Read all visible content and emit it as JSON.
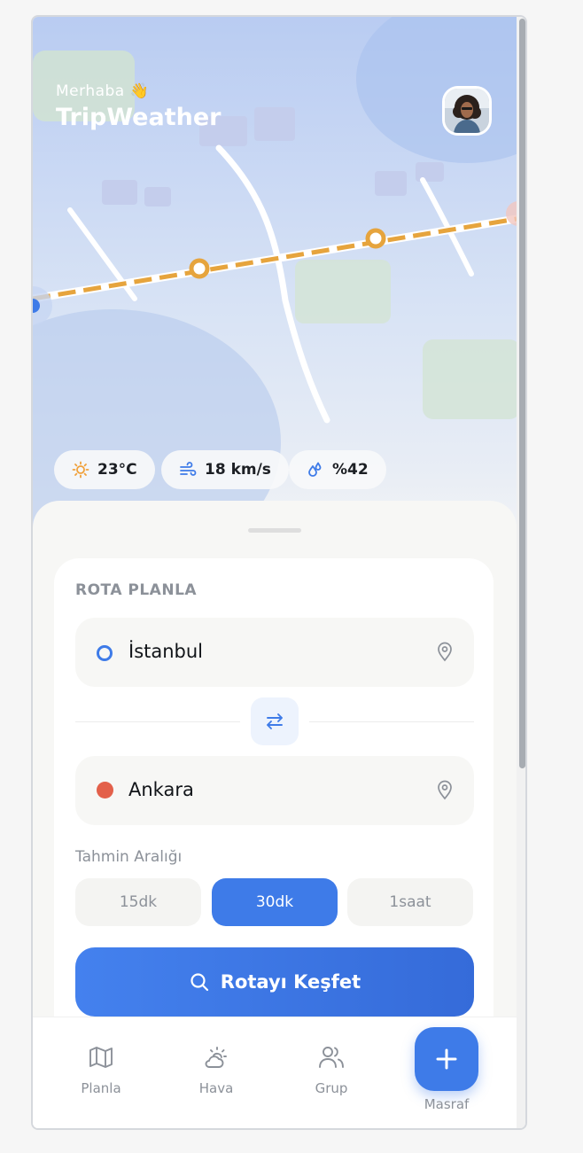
{
  "header": {
    "greeting": "Merhaba 👋",
    "app_name": "TripWeather"
  },
  "weather": {
    "temperature": "23°C",
    "wind": "18 km/s",
    "humidity": "%42"
  },
  "route": {
    "title": "ROTA PLANLA",
    "origin": "İstanbul",
    "destination": "Ankara",
    "interval_label": "Tahmin Aralığı",
    "intervals": [
      "15dk",
      "30dk",
      "1saat"
    ],
    "selected_interval": "30dk",
    "cta_label": "Rotayı Keşfet"
  },
  "nav": {
    "items": [
      "Planla",
      "Hava",
      "Grup",
      "Masraf"
    ]
  },
  "colors": {
    "accent": "#3e7be8",
    "route_line": "#e6a43d",
    "destination_dot": "#e3604a"
  }
}
